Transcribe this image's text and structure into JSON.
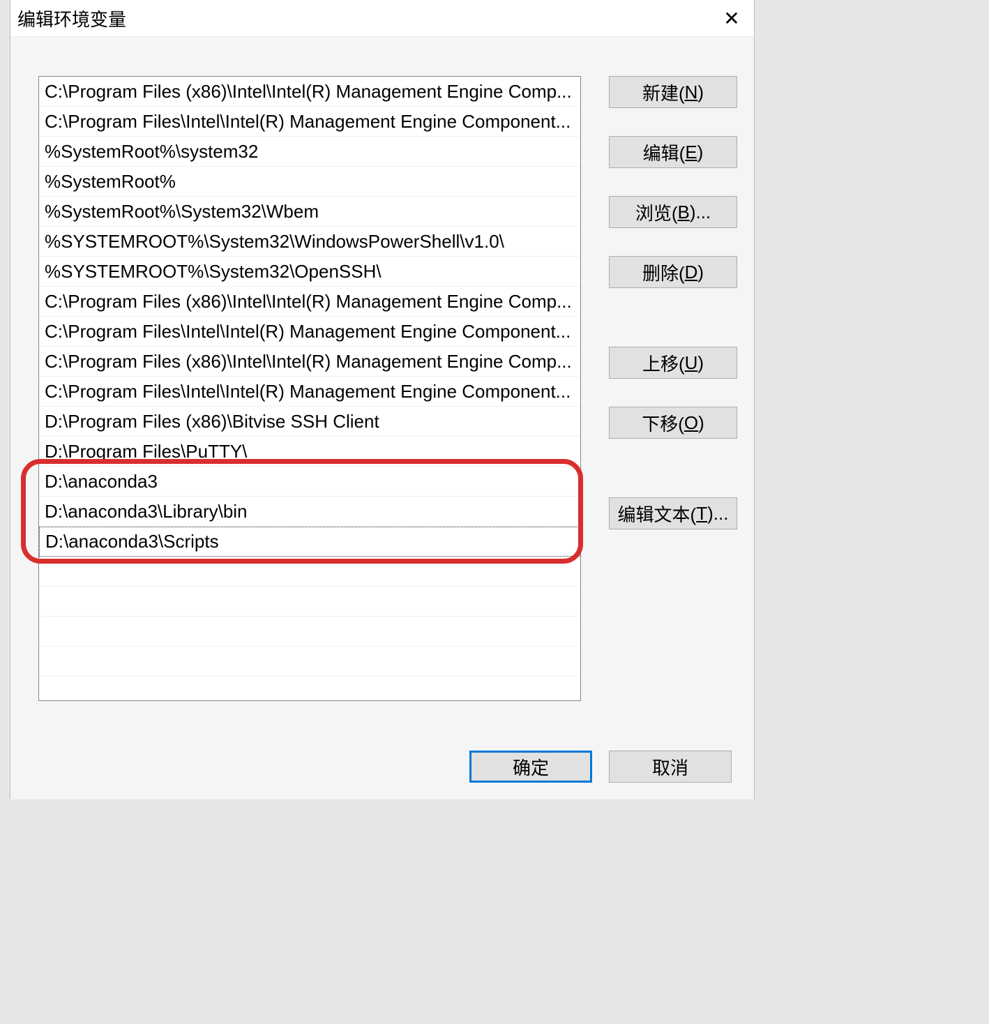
{
  "dialog": {
    "title": "编辑环境变量"
  },
  "paths": [
    "C:\\Program Files (x86)\\Intel\\Intel(R) Management Engine Comp...",
    "C:\\Program Files\\Intel\\Intel(R) Management Engine Component...",
    "%SystemRoot%\\system32",
    "%SystemRoot%",
    "%SystemRoot%\\System32\\Wbem",
    "%SYSTEMROOT%\\System32\\WindowsPowerShell\\v1.0\\",
    "%SYSTEMROOT%\\System32\\OpenSSH\\",
    "C:\\Program Files (x86)\\Intel\\Intel(R) Management Engine Comp...",
    "C:\\Program Files\\Intel\\Intel(R) Management Engine Component...",
    "C:\\Program Files (x86)\\Intel\\Intel(R) Management Engine Comp...",
    "C:\\Program Files\\Intel\\Intel(R) Management Engine Component...",
    "D:\\Program Files (x86)\\Bitvise SSH Client",
    "D:\\Program Files\\PuTTY\\",
    "D:\\anaconda3",
    "D:\\anaconda3\\Library\\bin",
    "D:\\anaconda3\\Scripts"
  ],
  "buttons": {
    "new": {
      "pre": "新建(",
      "hot": "N",
      "post": ")"
    },
    "edit": {
      "pre": "编辑(",
      "hot": "E",
      "post": ")"
    },
    "browse": {
      "pre": "浏览(",
      "hot": "B",
      "post": ")..."
    },
    "delete": {
      "pre": "删除(",
      "hot": "D",
      "post": ")"
    },
    "moveup": {
      "pre": "上移(",
      "hot": "U",
      "post": ")"
    },
    "movedown": {
      "pre": "下移(",
      "hot": "O",
      "post": ")"
    },
    "edittext": {
      "pre": "编辑文本(",
      "hot": "T",
      "post": ")..."
    },
    "ok": "确定",
    "cancel": "取消"
  },
  "focused_index": 15
}
